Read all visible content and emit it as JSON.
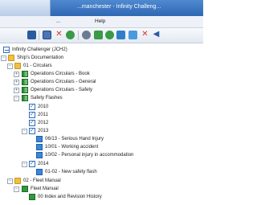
{
  "window": {
    "title": "...manchester - Infinity Challeng..."
  },
  "menu": {
    "items": [
      "...",
      "Help"
    ]
  },
  "toolbar": {
    "icons": [
      "print-icon",
      "save-icon",
      "close-icon",
      "refresh-icon",
      "settings-icon",
      "find-icon",
      "copy-icon",
      "paste-icon",
      "delete-icon",
      "back-icon"
    ]
  },
  "tree": {
    "root": "Infinity Challenger (JCH2)",
    "ship_docs": "Ship's Documentation",
    "n01": "01 - Circulars",
    "c_book": "Operations Circulars - Book",
    "c_general": "Operations Circulars - General",
    "c_safety": "Operations Circulars - Safety",
    "safety_flashes": "Safety Flashes",
    "y2010": "2010",
    "y2011": "2011",
    "y2012": "2012",
    "y2013": "2013",
    "f1": "06/13 - Serious Hand Injury",
    "f2": "10/01 - Working accident",
    "f3": "10/02 - Personal injury in accommodation",
    "y2014": "2014",
    "f4": "01-02 - New safety flash",
    "n02": "02 - Fleet Manual",
    "fleet_manual": "Fleet Manual",
    "history": "00 Index and Revision History"
  }
}
